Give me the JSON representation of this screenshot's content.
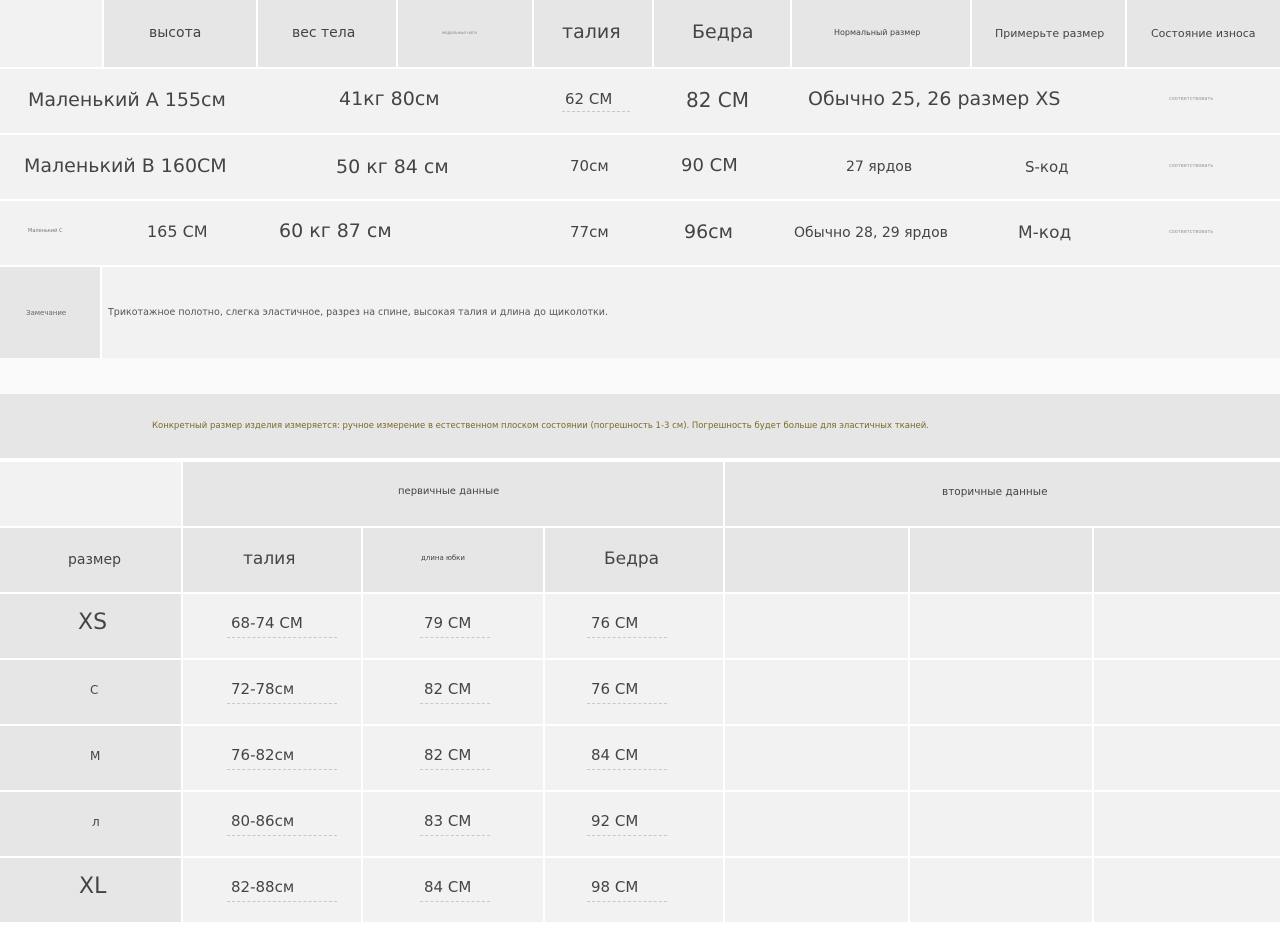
{
  "table1": {
    "headers": [
      "высота",
      "вес тела",
      "модельные ноги",
      "талия",
      "Бедра",
      "Нормальный размер",
      "Примерьте размер",
      "Состояние износа"
    ],
    "rows": [
      {
        "model": "Маленький А 155см",
        "weight": "41кг 80см",
        "waist": "62 СМ",
        "hips": "82 СМ",
        "normal": "Обычно 25, 26 размер XS",
        "wear": "соответствовать"
      },
      {
        "model": "Маленький В 160СМ",
        "weight": "50 кг 84 см",
        "waist": "70см",
        "hips": "90 СМ",
        "normal": "27 ярдов",
        "try": "S-код",
        "wear": "соответствовать"
      },
      {
        "model": "Маленький С",
        "height": "165 СМ",
        "weight": "60 кг 87 см",
        "waist": "77см",
        "hips": "96см",
        "normal": "Обычно 28, 29 ярдов",
        "try": "М-код",
        "wear": "соответствовать"
      }
    ],
    "note_label": "Замечание",
    "note_text": "Трикотажное полотно, слегка эластичное, разрез на спине, высокая талия и длина до щиколотки."
  },
  "table2": {
    "banner": "Конкретный размер изделия измеряется: ручное измерение в естественном плоском состоянии (погрешность 1-3 см). Погрешность будет больше для эластичных тканей.",
    "group_primary": "первичные данные",
    "group_secondary": "вторичные данные",
    "col_size": "размер",
    "col_waist": "талия",
    "col_length": "длина юбки",
    "col_hips": "Бедра",
    "rows": [
      {
        "size": "XS",
        "waist": "68-74 СМ",
        "length": "79 СМ",
        "hips": "76 СМ"
      },
      {
        "size": "С",
        "waist": "72-78см",
        "length": "82 СМ",
        "hips": "76 СМ"
      },
      {
        "size": "М",
        "waist": "76-82см",
        "length": "82 СМ",
        "hips": "84 СМ"
      },
      {
        "size": "л",
        "waist": "80-86см",
        "length": "83 СМ",
        "hips": "92 СМ"
      },
      {
        "size": "XL",
        "waist": "82-88см",
        "length": "84 СМ",
        "hips": "98 СМ"
      }
    ]
  },
  "colors": {
    "cell": "#f2f2f2",
    "header": "#e6e6e6",
    "banner_text": "#7a6a2a"
  }
}
